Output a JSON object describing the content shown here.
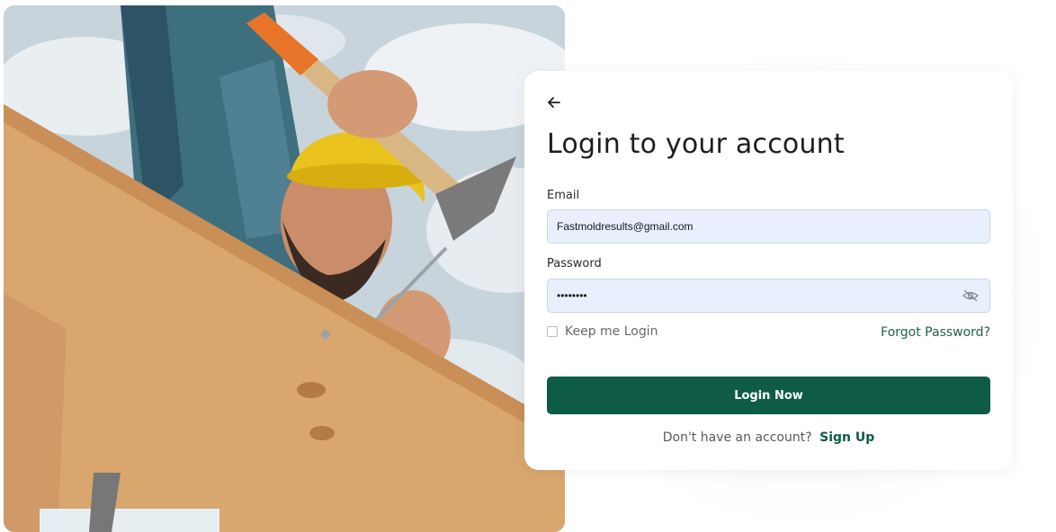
{
  "login": {
    "title": "Login to your account",
    "email_label": "Email",
    "email_value": "Fastmoldresults@gmail.com",
    "password_label": "Password",
    "password_value": "••••••••",
    "remember_label": "Keep me Login",
    "forgot_label": "Forgot Password?",
    "submit_label": "Login Now",
    "signup_prompt": "Don't have an account?",
    "signup_link": "Sign Up"
  },
  "icons": {
    "back": "arrow-left-icon",
    "password_toggle": "eye-off-icon"
  },
  "colors": {
    "primary": "#0e5c45",
    "input_bg": "#e8f0fe",
    "link": "#1f5f4c"
  }
}
